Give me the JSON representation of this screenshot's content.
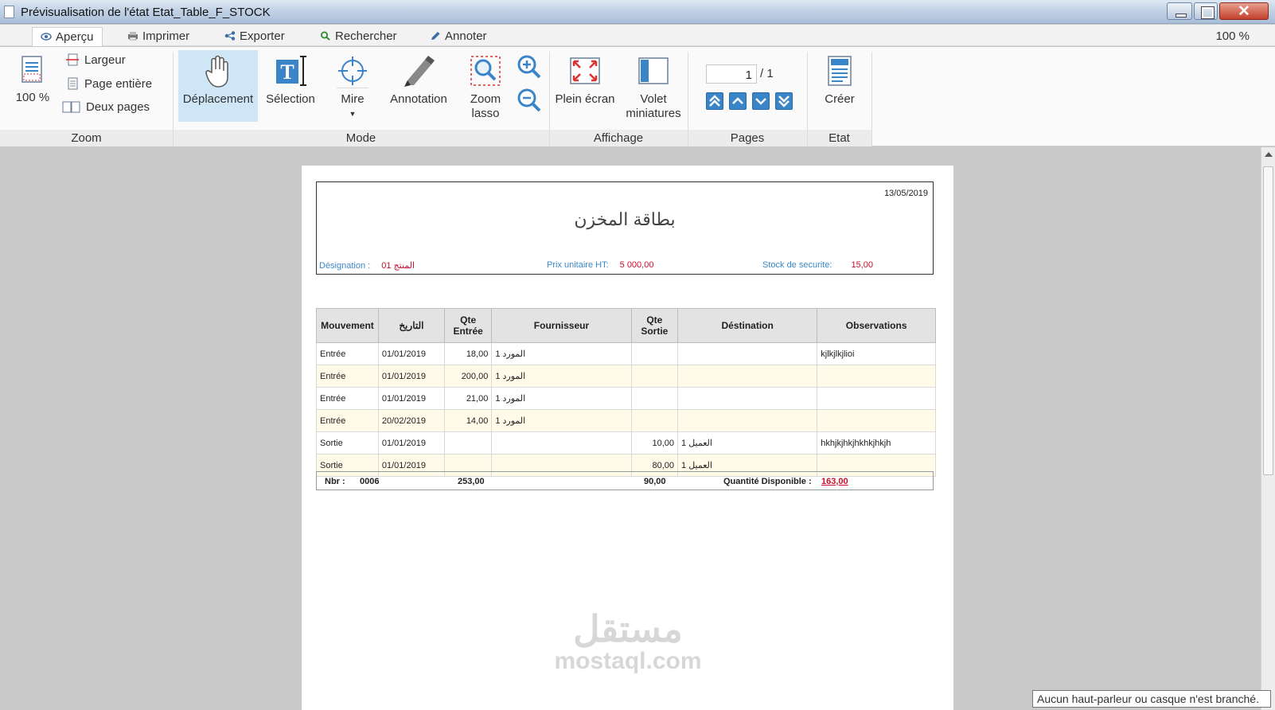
{
  "window": {
    "title": "Prévisualisation de l'état Etat_Table_F_STOCK"
  },
  "tabs": [
    {
      "label": "Aperçu",
      "icon": "eye-icon"
    },
    {
      "label": "Imprimer",
      "icon": "printer-icon"
    },
    {
      "label": "Exporter",
      "icon": "share-icon"
    },
    {
      "label": "Rechercher",
      "icon": "search-icon"
    },
    {
      "label": "Annoter",
      "icon": "pencil-icon"
    }
  ],
  "zoom_readout": "100 %",
  "ribbon": {
    "zoom": {
      "zoom_label": "100 %",
      "largeur": "Largeur",
      "page_entiere": "Page entière",
      "deux_pages": "Deux pages",
      "group": "Zoom"
    },
    "mode": {
      "deplacement": "Déplacement",
      "selection": "Sélection",
      "mire": "Mire",
      "annotation": "Annotation",
      "zoom_lasso_1": "Zoom",
      "zoom_lasso_2": "lasso",
      "group": "Mode"
    },
    "affichage": {
      "plein_ecran": "Plein écran",
      "volet_1": "Volet",
      "volet_2": "miniatures",
      "group": "Affichage"
    },
    "pages": {
      "current": "1",
      "total": "/ 1",
      "group": "Pages"
    },
    "etat": {
      "creer": "Créer",
      "group": "Etat"
    }
  },
  "document": {
    "date": "13/05/2019",
    "title": "بطاقة المخزن",
    "designation_label": "Désignation :",
    "designation_value": "المنتج 01",
    "prix_label": "Prix unitaire HT:",
    "prix_value": "5 000,00",
    "stock_label": "Stock de securite:",
    "stock_value": "15,00",
    "columns": {
      "mouvement": "Mouvement",
      "date": "التاريخ",
      "qte_entree_1": "Qte",
      "qte_entree_2": "Entrée",
      "fournisseur": "Fournisseur",
      "qte_sortie_1": "Qte",
      "qte_sortie_2": "Sortie",
      "destination": "Déstination",
      "observations": "Observations"
    },
    "rows": [
      {
        "mouvement": "Entrée",
        "date": "01/01/2019",
        "qte_entree": "18,00",
        "fournisseur": "المورد 1",
        "qte_sortie": "",
        "destination": "",
        "observations": "kjlkjlkjlioi"
      },
      {
        "mouvement": "Entrée",
        "date": "01/01/2019",
        "qte_entree": "200,00",
        "fournisseur": "المورد 1",
        "qte_sortie": "",
        "destination": "",
        "observations": ""
      },
      {
        "mouvement": "Entrée",
        "date": "01/01/2019",
        "qte_entree": "21,00",
        "fournisseur": "المورد 1",
        "qte_sortie": "",
        "destination": "",
        "observations": ""
      },
      {
        "mouvement": "Entrée",
        "date": "20/02/2019",
        "qte_entree": "14,00",
        "fournisseur": "المورد 1",
        "qte_sortie": "",
        "destination": "",
        "observations": ""
      },
      {
        "mouvement": "Sortie",
        "date": "01/01/2019",
        "qte_entree": "",
        "fournisseur": "",
        "qte_sortie": "10,00",
        "destination": "العميل 1",
        "observations": "hkhjkjhkjhkhkjhkjh"
      },
      {
        "mouvement": "Sortie",
        "date": "01/01/2019",
        "qte_entree": "",
        "fournisseur": "",
        "qte_sortie": "80,00",
        "destination": "العميل 1",
        "observations": ""
      }
    ],
    "footer": {
      "nbr_label": "Nbr :",
      "nbr_value": "0006",
      "total_entree": "253,00",
      "total_sortie": "90,00",
      "qty_label": "Quantité Disponible :",
      "qty_value": "163,00"
    }
  },
  "watermark": {
    "arabic": "مستقل",
    "latin": "mostaql.com"
  },
  "tooltip": "Aucun haut-parleur ou casque n'est branché.",
  "colors": {
    "accent": "#3a84c8",
    "highlight": "#cfe6f7",
    "value_red": "#c8102e",
    "label_blue": "#3a88c8",
    "alt_row": "#fffbe8"
  }
}
